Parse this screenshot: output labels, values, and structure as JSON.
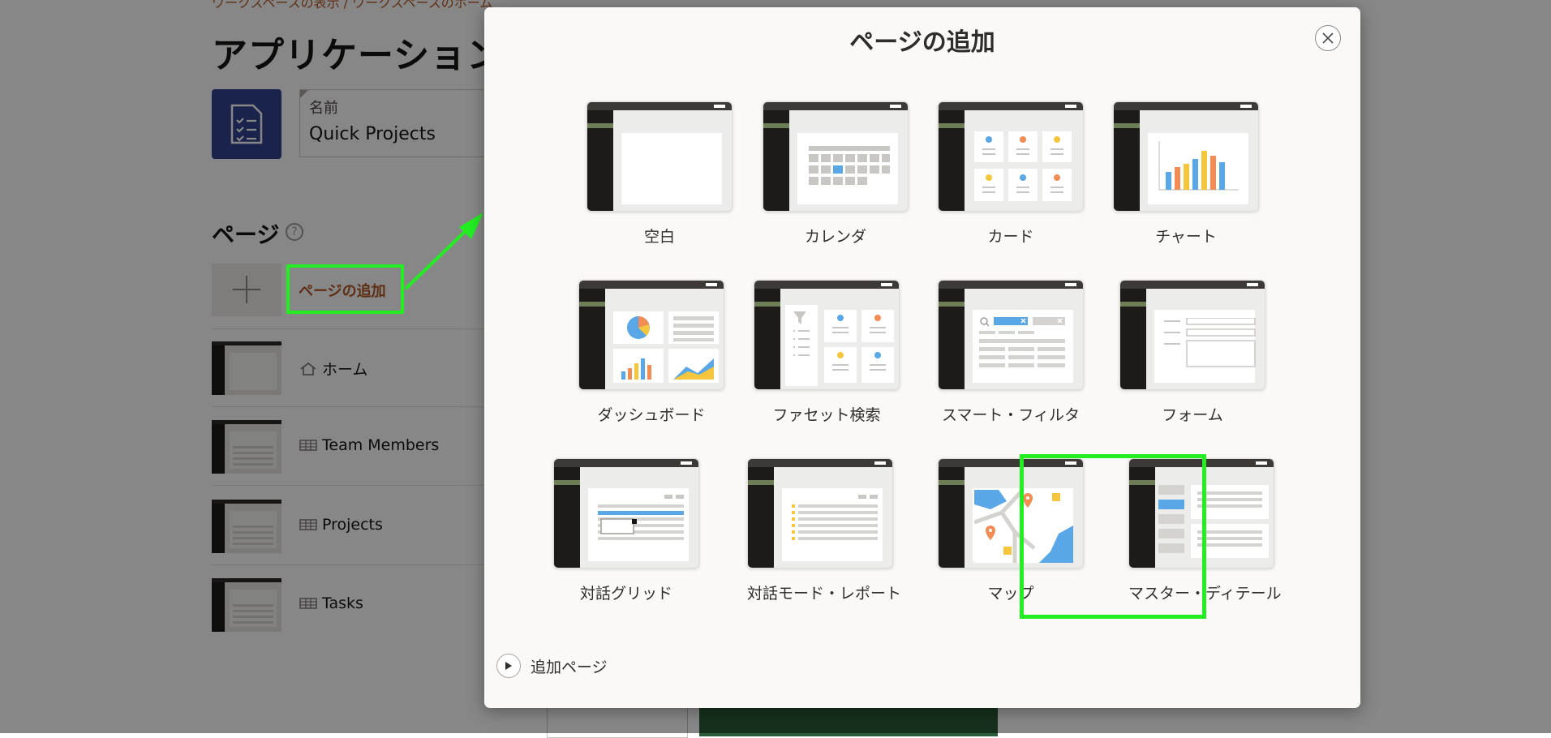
{
  "background": {
    "breadcrumb": "ワークスペースの表示 / ワークスペースのホーム",
    "title": "アプリケーション",
    "app_name_label": "名前",
    "app_name_value": "Quick Projects",
    "pages_heading": "ページ",
    "help_glyph": "?",
    "add_page_link": "ページの追加",
    "rows": [
      {
        "label": "ホーム",
        "icon": "home-icon"
      },
      {
        "label": "Team Members",
        "icon": "table-icon"
      },
      {
        "label": "Projects",
        "icon": "table-icon"
      },
      {
        "label": "Tasks",
        "icon": "table-icon"
      }
    ]
  },
  "dialog": {
    "title": "ページの追加",
    "close_icon": "close-icon",
    "tiles": [
      {
        "label": "空白",
        "icon": "blank-page-icon"
      },
      {
        "label": "カレンダ",
        "icon": "calendar-page-icon"
      },
      {
        "label": "カード",
        "icon": "cards-page-icon"
      },
      {
        "label": "チャート",
        "icon": "chart-page-icon"
      },
      {
        "label": "ダッシュボード",
        "icon": "dashboard-page-icon"
      },
      {
        "label": "ファセット検索",
        "icon": "faceted-search-page-icon"
      },
      {
        "label": "スマート・フィルタ",
        "icon": "smart-filter-page-icon"
      },
      {
        "label": "フォーム",
        "icon": "form-page-icon"
      },
      {
        "label": "対話グリッド",
        "icon": "interactive-grid-page-icon"
      },
      {
        "label": "対話モード・レポート",
        "icon": "interactive-report-page-icon"
      },
      {
        "label": "マップ",
        "icon": "map-page-icon"
      },
      {
        "label": "マスター・ディテール",
        "icon": "master-detail-page-icon"
      }
    ],
    "more_pages": "追加ページ",
    "highlight_color": "#22ee22"
  }
}
